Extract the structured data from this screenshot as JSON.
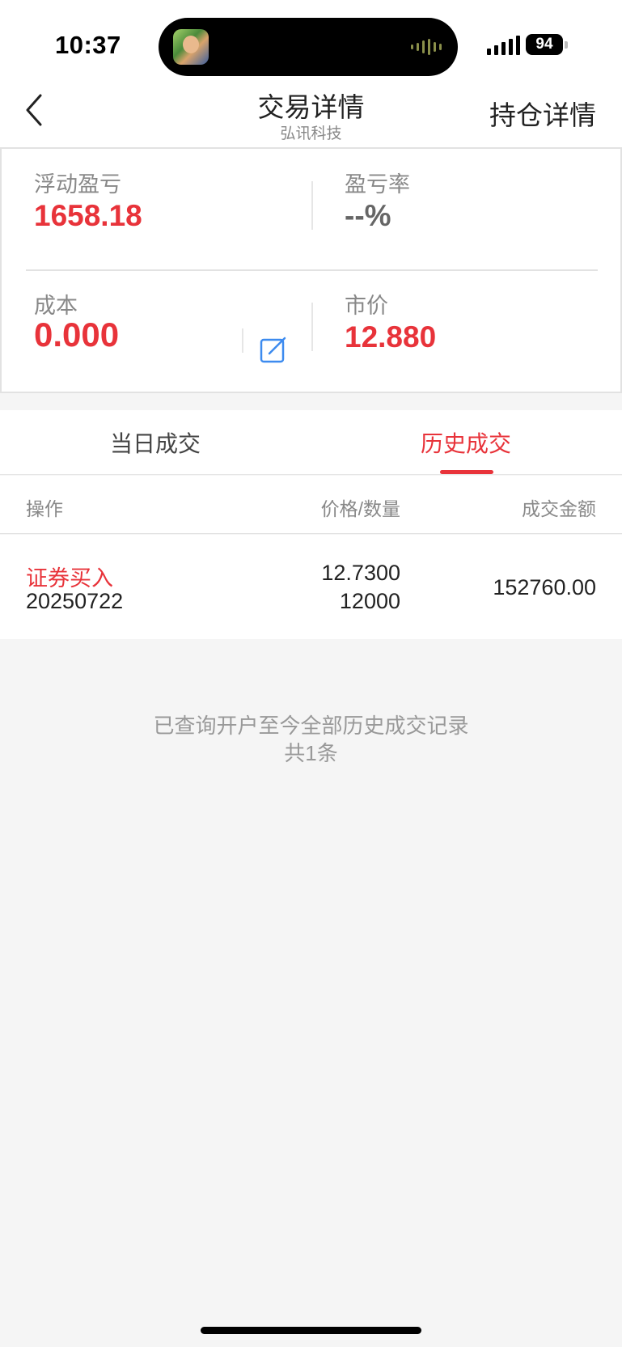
{
  "status_bar": {
    "time": "10:37",
    "battery": "94"
  },
  "nav": {
    "title": "交易详情",
    "subtitle": "弘讯科技",
    "right_action": "持仓详情",
    "back_icon": "chevron-left-icon"
  },
  "summary": {
    "floating_pnl": {
      "label": "浮动盈亏",
      "value": "1658.18"
    },
    "pnl_rate": {
      "label": "盈亏率",
      "value": "--%"
    },
    "cost": {
      "label": "成本",
      "value": "0.000"
    },
    "market_price": {
      "label": "市价",
      "value": "12.880"
    },
    "edit_icon": "edit-icon"
  },
  "tabs": [
    {
      "label": "当日成交",
      "active": false
    },
    {
      "label": "历史成交",
      "active": true
    }
  ],
  "table": {
    "headers": {
      "operation": "操作",
      "price_qty": "价格/数量",
      "amount": "成交金额"
    },
    "rows": [
      {
        "operation": "证券买入",
        "date": "20250722",
        "price": "12.7300",
        "quantity": "12000",
        "amount": "152760.00"
      }
    ]
  },
  "footer": {
    "line1": "已查询开户至今全部历史成交记录",
    "line2": "共1条"
  },
  "colors": {
    "accent_red": "#e8333a",
    "text_grey": "#888888",
    "background": "#f5f5f5"
  }
}
